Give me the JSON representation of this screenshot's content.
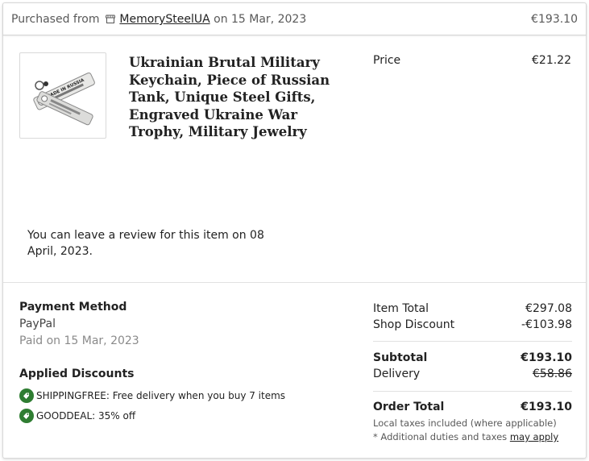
{
  "header": {
    "purchased_prefix": "Purchased from",
    "shop_name": "MemorySteelUA",
    "date_text": "on 15 Mar, 2023",
    "order_total": "€193.10"
  },
  "item": {
    "title": "Ukrainian Brutal Military Keychain, Piece of Russian Tank, Unique Steel Gifts, Engraved Ukraine War Trophy, Military Jewelry",
    "price_label": "Price",
    "price": "€21.22",
    "review_note": "You can leave a review for this item on 08 April, 2023.",
    "thumbnail_text": "MADE IN RUSSIA"
  },
  "payment": {
    "title": "Payment Method",
    "method": "PayPal",
    "paid_on": "Paid on 15 Mar, 2023"
  },
  "discounts": {
    "title": "Applied Discounts",
    "items": [
      {
        "text": "SHIPPINGFREE: Free delivery when you buy 7 items"
      },
      {
        "text": "GOODDEAL: 35% off"
      }
    ]
  },
  "totals": {
    "item_total_label": "Item Total",
    "item_total": "€297.08",
    "shop_discount_label": "Shop Discount",
    "shop_discount": "-€103.98",
    "subtotal_label": "Subtotal",
    "subtotal": "€193.10",
    "delivery_label": "Delivery",
    "delivery": "€58.86",
    "order_total_label": "Order Total",
    "order_total": "€193.10",
    "tax_note": "Local taxes included (where applicable)",
    "duties_note": "* Additional duties and taxes",
    "duties_link": "may apply"
  },
  "colors": {
    "discount_tag": "#2f7d32",
    "border": "#d9d9d9",
    "muted_text": "#595959"
  },
  "icons": {
    "shop": "shop-icon",
    "discount": "discount-tag-icon"
  }
}
